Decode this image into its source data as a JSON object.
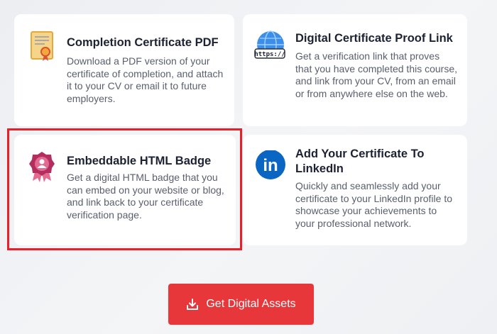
{
  "cards": [
    {
      "title": "Completion Certificate PDF",
      "description": "Download a PDF version of your certificate of completion, and attach it to your CV or email it to future employers.",
      "icon": "certificate-document-icon"
    },
    {
      "title": "Digital Certificate Proof Link",
      "description": "Get a verification link that proves that you have completed this course, and link from your CV, from an email or from anywhere else on the web.",
      "icon": "globe-link-icon",
      "icon_text": "https://"
    },
    {
      "title": "Embeddable HTML Badge",
      "description": "Get a digital HTML badge that you can embed on your website or blog, and link back to your certificate verification page.",
      "icon": "ribbon-badge-icon"
    },
    {
      "title": "Add Your Certificate To LinkedIn",
      "description": "Quickly and seamlessly add your certificate to your LinkedIn profile to showcase your achievements to your professional network.",
      "icon": "linkedin-icon",
      "icon_text": "in"
    }
  ],
  "cta": {
    "label": "Get Digital Assets",
    "icon": "download-icon"
  },
  "colors": {
    "accent": "#e8373b",
    "highlight": "#e8202a",
    "linkedin": "#0a66c2"
  }
}
